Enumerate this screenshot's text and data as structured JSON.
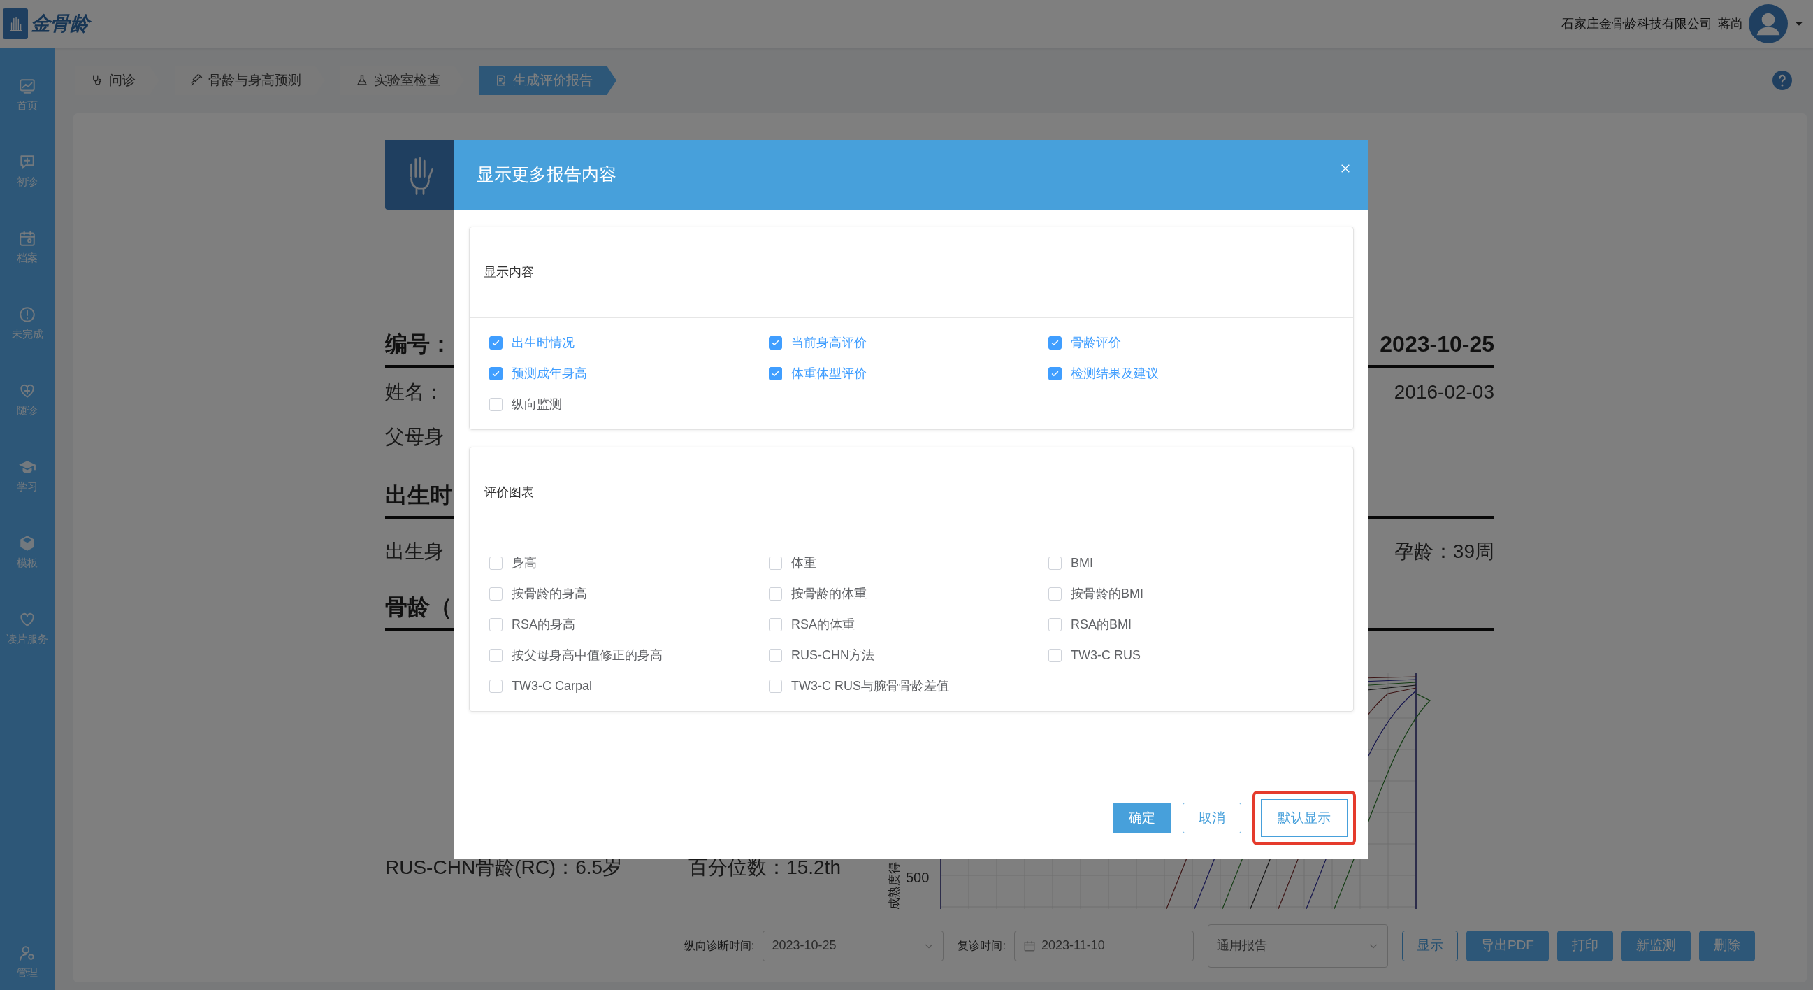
{
  "header": {
    "logo_text": "金骨龄",
    "company": "石家庄金骨龄科技有限公司",
    "user": "蒋尚"
  },
  "sidebar": {
    "items": [
      {
        "label": "首页",
        "selected": false
      },
      {
        "label": "初诊",
        "selected": false
      },
      {
        "label": "档案",
        "selected": false
      },
      {
        "label": "未完成",
        "selected": false
      },
      {
        "label": "随诊",
        "selected": false
      },
      {
        "label": "学习",
        "selected": false
      },
      {
        "label": "模板",
        "selected": false
      },
      {
        "label": "读片服务",
        "selected": false
      }
    ],
    "bottom_item": {
      "label": "管理"
    }
  },
  "steps": [
    {
      "label": "问诊",
      "selected": false
    },
    {
      "label": "骨龄与身高预测",
      "selected": false
    },
    {
      "label": "实验室检查",
      "selected": false
    },
    {
      "label": "生成评价报告",
      "selected": true
    }
  ],
  "report": {
    "number_label": "编号：",
    "date": "2023-10-25",
    "name_label": "姓名：",
    "birth_date": "2016-02-03",
    "parents_label": "父母身",
    "section_birth": "出生时",
    "birth_length_label": "出生身",
    "gestation": "孕龄：39周",
    "section_bone": "骨龄（",
    "rc_age": "RUS-CHN骨龄(RC)：6.5岁",
    "percentile": "百分位数：15.2th",
    "chart_tick": "500",
    "chart_ylabel": "成熟度得"
  },
  "dialog": {
    "title": "显示更多报告内容",
    "sections": [
      {
        "title": "显示内容",
        "options": [
          {
            "label": "出生时情况",
            "checked": true
          },
          {
            "label": "当前身高评价",
            "checked": true
          },
          {
            "label": "骨龄评价",
            "checked": true
          },
          {
            "label": "预测成年身高",
            "checked": true
          },
          {
            "label": "体重体型评价",
            "checked": true
          },
          {
            "label": "检测结果及建议",
            "checked": true
          },
          {
            "label": "纵向监测",
            "checked": false
          }
        ]
      },
      {
        "title": "评价图表",
        "options": [
          {
            "label": "身高",
            "checked": false
          },
          {
            "label": "体重",
            "checked": false
          },
          {
            "label": "BMI",
            "checked": false
          },
          {
            "label": "按骨龄的身高",
            "checked": false
          },
          {
            "label": "按骨龄的体重",
            "checked": false
          },
          {
            "label": "按骨龄的BMI",
            "checked": false
          },
          {
            "label": "RSA的身高",
            "checked": false
          },
          {
            "label": "RSA的体重",
            "checked": false
          },
          {
            "label": "RSA的BMI",
            "checked": false
          },
          {
            "label": "按父母身高中值修正的身高",
            "checked": false
          },
          {
            "label": "RUS-CHN方法",
            "checked": false
          },
          {
            "label": "TW3-C RUS",
            "checked": false
          },
          {
            "label": "TW3-C Carpal",
            "checked": false
          },
          {
            "label": "TW3-C RUS与腕骨骨龄差值",
            "checked": false
          }
        ]
      }
    ],
    "buttons": [
      {
        "label": "确定",
        "kind": "primary",
        "highlighted": false
      },
      {
        "label": "取消",
        "kind": "outline",
        "highlighted": false
      },
      {
        "label": "默认显示",
        "kind": "outline",
        "highlighted": true
      }
    ]
  },
  "toolbar": {
    "diagnosis_time_label": "纵向诊断时间:",
    "diagnosis_time": "2023-10-25",
    "revisit_label": "复诊时间:",
    "revisit_date": "2023-11-10",
    "report_type": "通用报告",
    "buttons": [
      {
        "label": "显示",
        "kind": "outline"
      },
      {
        "label": "导出PDF",
        "kind": "primary"
      },
      {
        "label": "打印",
        "kind": "primary"
      },
      {
        "label": "新监测",
        "kind": "primary"
      },
      {
        "label": "删除",
        "kind": "primary"
      }
    ]
  }
}
